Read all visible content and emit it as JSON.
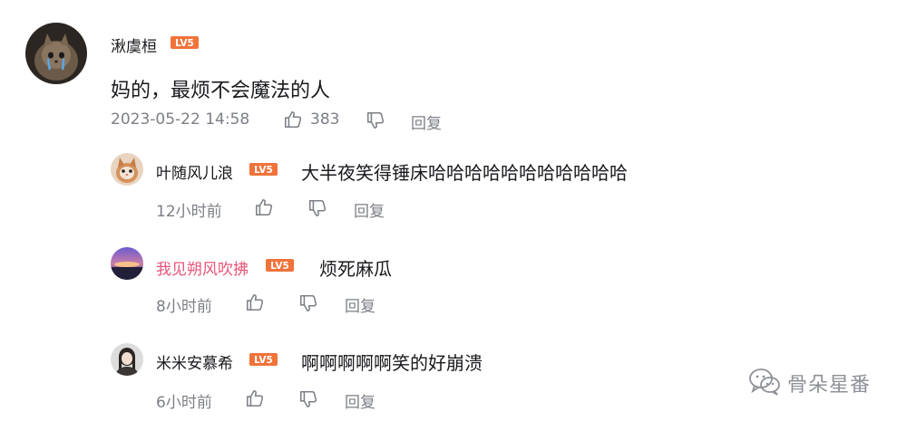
{
  "comment": {
    "username": "湫虞桓",
    "level": "LV5",
    "text": "妈的，最烦不会魔法的人",
    "timestamp": "2023-05-22 14:58",
    "likes": "383",
    "reply_label": "回复"
  },
  "replies": [
    {
      "username": "叶随风儿浪",
      "level": "LV5",
      "text": "大半夜笑得锤床哈哈哈哈哈哈哈哈哈哈哈",
      "timestamp": "12小时前",
      "reply_label": "回复"
    },
    {
      "username": "我见朔风吹拂",
      "level": "LV5",
      "text": "烦死麻瓜",
      "timestamp": "8小时前",
      "reply_label": "回复"
    },
    {
      "username": "米米安慕希",
      "level": "LV5",
      "text": "啊啊啊啊啊笑的好崩溃",
      "timestamp": "6小时前",
      "reply_label": "回复"
    }
  ],
  "watermark": {
    "text": "骨朵星番"
  },
  "colors": {
    "level_badge": "#f0733a",
    "vip_name": "#e8557a",
    "meta": "#7c7f86"
  }
}
